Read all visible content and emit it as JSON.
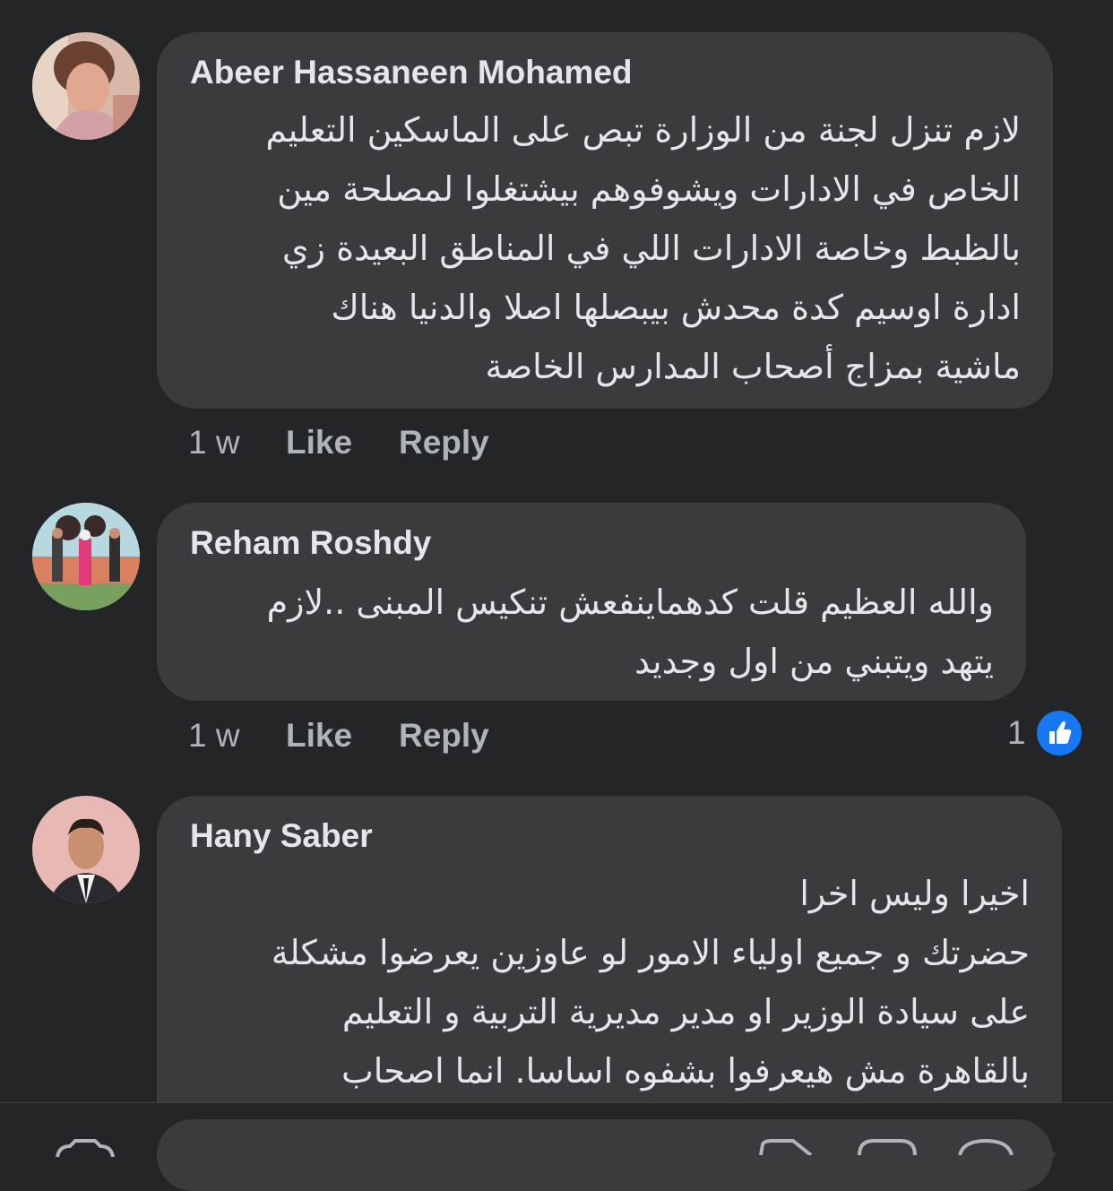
{
  "comments": [
    {
      "author": "Abeer Hassaneen Mohamed",
      "lines": [
        "لازم تنزل لجنة من الوزارة تبص على الماسكين التعليم",
        "الخاص في الادارات ويشوفوهم بيشتغلوا لمصلحة مين",
        "بالظبط وخاصة الادارات اللي في المناطق البعيدة زي",
        "ادارة اوسيم كدة محدش بيبصلها اصلا والدنيا هناك",
        "ماشية بمزاج أصحاب المدارس الخاصة"
      ],
      "time": "1 w",
      "like_label": "Like",
      "reply_label": "Reply"
    },
    {
      "author": "Reham Roshdy",
      "lines": [
        "والله العظيم قلت كدهماينفعش تنكيس المبنى ..لازم",
        "يتهد ويتبني من اول وجديد"
      ],
      "time": "1 w",
      "like_label": "Like",
      "reply_label": "Reply",
      "reaction_count": "1"
    },
    {
      "author": "Hany Saber",
      "lines": [
        "اخيرا وليس اخرا",
        "حضرتك و جميع اولياء الامور لو عاوزين يعرضوا مشكلة",
        "على سيادة الوزير او مدير مديرية التربية و التعليم",
        "بالقاهرة  مش هيعرفوا بشفوه اساسا. انما اصحاب"
      ]
    }
  ],
  "icons": {
    "like_reaction": "thumbs-up-icon",
    "camera": "camera-icon",
    "gif": "gif-icon",
    "sticker": "sticker-icon",
    "emoji": "emoji-icon"
  },
  "colors": {
    "background": "#242526",
    "bubble": "#3a3b3c",
    "text": "#e4e6eb",
    "secondary": "#b0b3b8",
    "like_blue": "#1877f2"
  }
}
